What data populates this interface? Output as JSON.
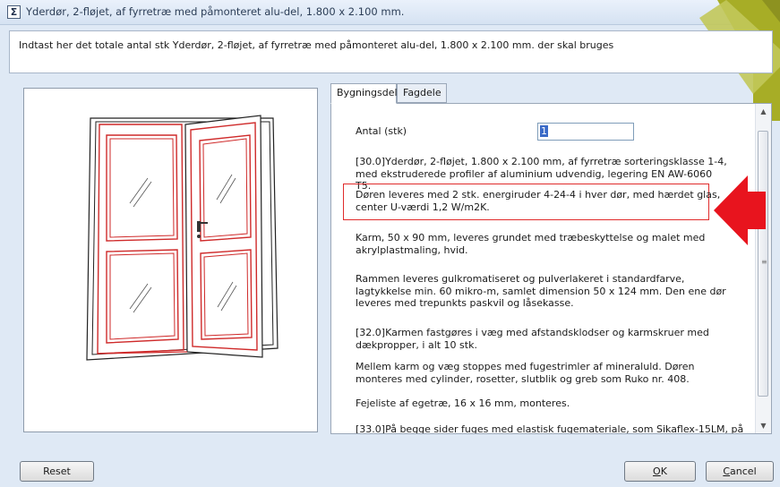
{
  "window": {
    "title": "Yderdør, 2-fløjet, af fyrretræ med påmonteret alu-del, 1.800 x 2.100 mm.",
    "icon": "sigma-icon"
  },
  "instruction": "Indtast her det totale antal stk Yderdør, 2-fløjet, af fyrretræ med påmonteret alu-del, 1.800 x 2.100 mm. der skal bruges",
  "tabs": [
    {
      "label": "Bygningsdel",
      "active": true
    },
    {
      "label": "Fagdele",
      "active": false
    }
  ],
  "form": {
    "antal_label": "Antal (stk)",
    "antal_value": "1"
  },
  "description": [
    "[30.0]Yderdør, 2-fløjet, 1.800 x 2.100 mm, af fyrretræ sorteringsklasse 1-4, med ekstruderede profiler af aluminium udvendig, legering EN AW-6060 T5.",
    "Døren leveres med 2 stk. energiruder 4-24-4 i hver dør, med hærdet glas, center U-værdi 1,2 W/m2K.",
    "Karm, 50 x 90 mm, leveres grundet med træbeskyttelse og malet med akrylplastmaling, hvid.",
    "Rammen leveres gulkromatiseret og pulverlakeret i standardfarve, lagtykkelse min. 60 mikro-m, samlet dimension 50 x 124 mm. Den ene dør leveres med trepunkts paskvil og låsekasse.",
    "[32.0]Karmen fastgøres i væg med afstandsklodser og karmskruer med dækpropper, i alt 10 stk.",
    "Mellem karm og væg stoppes med fugestrimler af mineraluld. Døren monteres med cylinder, rosetter, slutblik og greb som Ruko nr. 408.",
    "Fejeliste af egetræ, 16 x 16 mm, monteres.",
    "[33.0]På begge sider fuges med elastisk fugemateriale, som Sikaflex-15LM, på"
  ],
  "buttons": {
    "reset": "Reset",
    "ok_underlined": "O",
    "ok_rest": "K",
    "cancel_underlined": "C",
    "cancel_rest": "ancel"
  },
  "colors": {
    "highlight": "#e02b2b",
    "arrow": "#e8141e",
    "door_outline": "#cf2a2a",
    "selection": "#3a6ac7",
    "deco_green": "#a7ad26"
  },
  "icons": {
    "scroll_up": "▲",
    "scroll_down": "▼",
    "grip": "≡"
  }
}
